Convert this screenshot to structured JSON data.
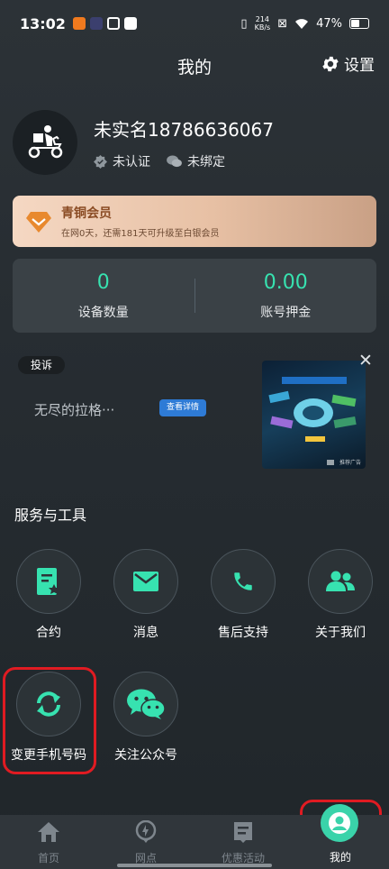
{
  "status_bar": {
    "time": "13:02",
    "net_speed_value": "214",
    "net_speed_unit": "KB/s",
    "battery": "47%",
    "battery_level": 0.47
  },
  "header": {
    "title": "我的",
    "settings_label": "设置"
  },
  "profile": {
    "name": "未实名18786636067",
    "auth_status": "未认证",
    "wechat_status": "未绑定"
  },
  "member": {
    "title": "青铜会员",
    "subtitle": "在网0天，还需181天可升级至白银会员"
  },
  "stats": [
    {
      "value": "0",
      "label": "设备数量"
    },
    {
      "value": "0.00",
      "label": "账号押金"
    }
  ],
  "ad": {
    "complain_label": "投诉",
    "text": "无尽的拉格···",
    "button_label": "查看详情",
    "corner_label": "推荐广告"
  },
  "services": {
    "title": "服务与工具",
    "items": [
      {
        "label": "合约",
        "icon": "contract-icon"
      },
      {
        "label": "消息",
        "icon": "mail-icon"
      },
      {
        "label": "售后支持",
        "icon": "phone-icon"
      },
      {
        "label": "关于我们",
        "icon": "users-icon"
      },
      {
        "label": "变更手机号码",
        "icon": "refresh-icon"
      },
      {
        "label": "关注公众号",
        "icon": "wechat-icon"
      }
    ]
  },
  "tabs": [
    {
      "label": "首页",
      "icon": "home-icon"
    },
    {
      "label": "网点",
      "icon": "location-icon"
    },
    {
      "label": "优惠活动",
      "icon": "document-icon"
    },
    {
      "label": "我的",
      "icon": "profile-icon",
      "active": true
    }
  ],
  "colors": {
    "accent": "#37e2b0",
    "highlight": "#e01b22",
    "background": "#262c31"
  }
}
